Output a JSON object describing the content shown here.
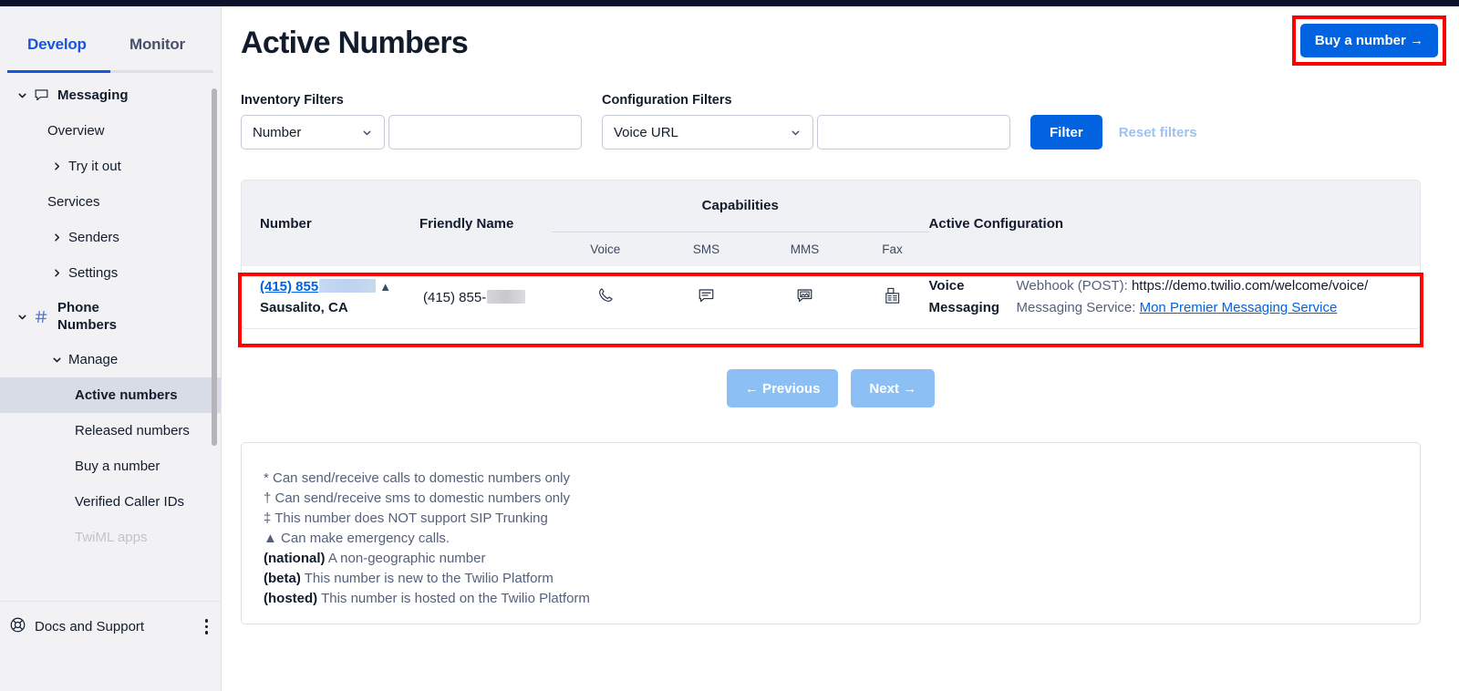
{
  "sidebar": {
    "tabs": [
      {
        "label": "Develop",
        "active": true
      },
      {
        "label": "Monitor",
        "active": false
      }
    ],
    "items": [
      {
        "label": "Messaging",
        "icon": "chat-icon",
        "chevron": "down",
        "indent": 0,
        "group": true
      },
      {
        "label": "Overview",
        "icon": "",
        "chevron": "",
        "indent": 1,
        "group": false
      },
      {
        "label": "Try it out",
        "icon": "",
        "chevron": "right",
        "indent": 2,
        "group": false
      },
      {
        "label": "Services",
        "icon": "",
        "chevron": "",
        "indent": 1,
        "group": false
      },
      {
        "label": "Senders",
        "icon": "",
        "chevron": "right",
        "indent": 2,
        "group": false
      },
      {
        "label": "Settings",
        "icon": "",
        "chevron": "right",
        "indent": 2,
        "group": false
      },
      {
        "label": "Phone Numbers",
        "icon": "hash-icon",
        "chevron": "down",
        "indent": 0,
        "group": true
      },
      {
        "label": "Manage",
        "icon": "",
        "chevron": "down",
        "indent": 2,
        "group": false
      },
      {
        "label": "Active numbers",
        "icon": "",
        "chevron": "",
        "indent": 3,
        "group": false
      },
      {
        "label": "Released numbers",
        "icon": "",
        "chevron": "",
        "indent": 3,
        "group": false
      },
      {
        "label": "Buy a number",
        "icon": "",
        "chevron": "",
        "indent": 3,
        "group": false
      },
      {
        "label": "Verified Caller IDs",
        "icon": "",
        "chevron": "",
        "indent": 3,
        "group": false
      },
      {
        "label": "TwiML apps",
        "icon": "",
        "chevron": "",
        "indent": 3,
        "group": false
      }
    ],
    "active_item": "Active numbers",
    "footer": {
      "label": "Docs and Support",
      "icon": "life-ring-icon",
      "menu_icon": "kebab-menu-icon"
    }
  },
  "header": {
    "title": "Active Numbers",
    "buy_button": "Buy a number  →"
  },
  "filters": {
    "inventory_label": "Inventory Filters",
    "inventory_select": "Number",
    "inventory_value": "",
    "inventory_placeholder": "",
    "configuration_label": "Configuration Filters",
    "configuration_select": "Voice URL",
    "configuration_value": "",
    "configuration_placeholder": "",
    "filter_button": "Filter",
    "reset_link": "Reset filters"
  },
  "table": {
    "columns": {
      "number": "Number",
      "friendly_name": "Friendly Name",
      "capabilities": "Capabilities",
      "active_configuration": "Active Configuration"
    },
    "capability_columns": [
      "Voice",
      "SMS",
      "MMS",
      "Fax"
    ],
    "rows": [
      {
        "number_prefix": "(415) 855",
        "number_redacted": true,
        "emergency_marker": "▲",
        "location": "Sausalito, CA",
        "friendly_name_prefix": "(415) 855-",
        "friendly_name_redacted": true,
        "capabilities": {
          "voice": "phone-icon",
          "sms": "chat-bubble-icon",
          "mms": "chat-bubble-image-icon",
          "fax": "fax-icon"
        },
        "config": [
          {
            "key": "Voice",
            "label": "Webhook (POST): ",
            "value": "https://demo.twilio.com/welcome/voice/",
            "link": false
          },
          {
            "key": "Messaging",
            "label": "Messaging Service: ",
            "value": "Mon Premier Messaging Service",
            "link": true
          }
        ]
      }
    ]
  },
  "pagination": {
    "previous": "←  Previous",
    "next": "Next  →"
  },
  "legend": [
    {
      "symbol": "*",
      "text": " Can send/receive calls to domestic numbers only",
      "bold_symbol": false
    },
    {
      "symbol": "†",
      "text": " Can send/receive sms to domestic numbers only",
      "bold_symbol": false
    },
    {
      "symbol": "‡",
      "text": " This number does NOT support SIP Trunking",
      "bold_symbol": false
    },
    {
      "symbol": "▲",
      "text": " Can make emergency calls.",
      "bold_symbol": false
    },
    {
      "symbol": "(national)",
      "text": " A non-geographic number",
      "bold_symbol": true
    },
    {
      "symbol": "(beta)",
      "text": " This number is new to the Twilio Platform",
      "bold_symbol": true
    },
    {
      "symbol": "(hosted)",
      "text": " This number is hosted on the Twilio Platform",
      "bold_symbol": true
    }
  ],
  "colors": {
    "accent_blue": "#0263e0",
    "tab_blue": "#1456e0",
    "annotation_red": "#ff0000",
    "disabled_blue": "#8cc0f5",
    "topbar_navy": "#0d122b"
  }
}
